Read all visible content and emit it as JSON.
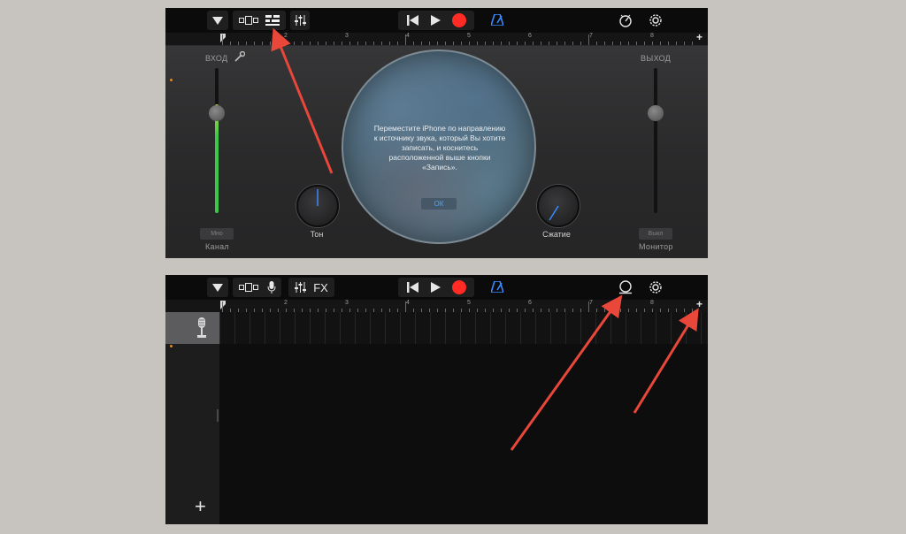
{
  "panel1": {
    "input_label": "ВХОД",
    "output_label": "ВЫХОД",
    "knob_left_label": "Тон",
    "knob_right_label": "Сжатие",
    "mono_button": "Мно",
    "channel_label": "Канал",
    "off_button": "Выкл",
    "monitor_label": "Монитор",
    "prompt_text": "Переместите iPhone по направлению к источнику звука, который Вы хотите записать, и коснитесь расположенной выше кнопки «Запись».",
    "ok_button": "ОК",
    "input_level": 0.75
  },
  "panel2": {
    "fx_label": "FX",
    "add_track": "+"
  },
  "ruler": {
    "numbers": [
      "2",
      "3",
      "4",
      "5",
      "6",
      "7",
      "8"
    ],
    "add": "+"
  },
  "colors": {
    "record": "#ff2b24",
    "metronome": "#3a8bff",
    "arrow": "#e8473a",
    "meter": "#39c84a"
  }
}
